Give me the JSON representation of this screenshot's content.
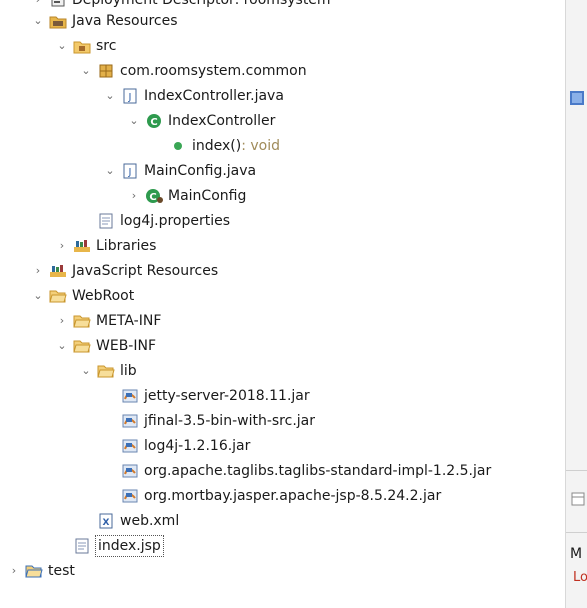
{
  "tree": {
    "deployment_descriptor": "Deployment Descriptor: roomsystem",
    "java_resources": "Java Resources",
    "src": "src",
    "package": "com.roomsystem.common",
    "index_controller_file": "IndexController.java",
    "index_controller_class": "IndexController",
    "index_method": "index()",
    "index_method_type": " : void",
    "main_config_file": "MainConfig.java",
    "main_config_class": "MainConfig",
    "log4j_properties": "log4j.properties",
    "libraries": "Libraries",
    "javascript_resources": "JavaScript Resources",
    "webroot": "WebRoot",
    "meta_inf": "META-INF",
    "web_inf": "WEB-INF",
    "lib": "lib",
    "jar1": "jetty-server-2018.11.jar",
    "jar2": "jfinal-3.5-bin-with-src.jar",
    "jar3": "log4j-1.2.16.jar",
    "jar4": "org.apache.taglibs.taglibs-standard-impl-1.2.5.jar",
    "jar5": "org.mortbay.jasper.apache-jsp-8.5.24.2.jar",
    "web_xml": "web.xml",
    "index_jsp": "index.jsp",
    "test": "test"
  },
  "side_panel": {
    "text1": "M",
    "text2": "Lo"
  },
  "colors": {
    "folder": "#e8b64a",
    "class_green": "#2e9a4e",
    "method_green": "#3aa655",
    "jar_blue": "#3b6fb6",
    "file_blue": "#2f5fa8",
    "error_red": "#c03020"
  }
}
